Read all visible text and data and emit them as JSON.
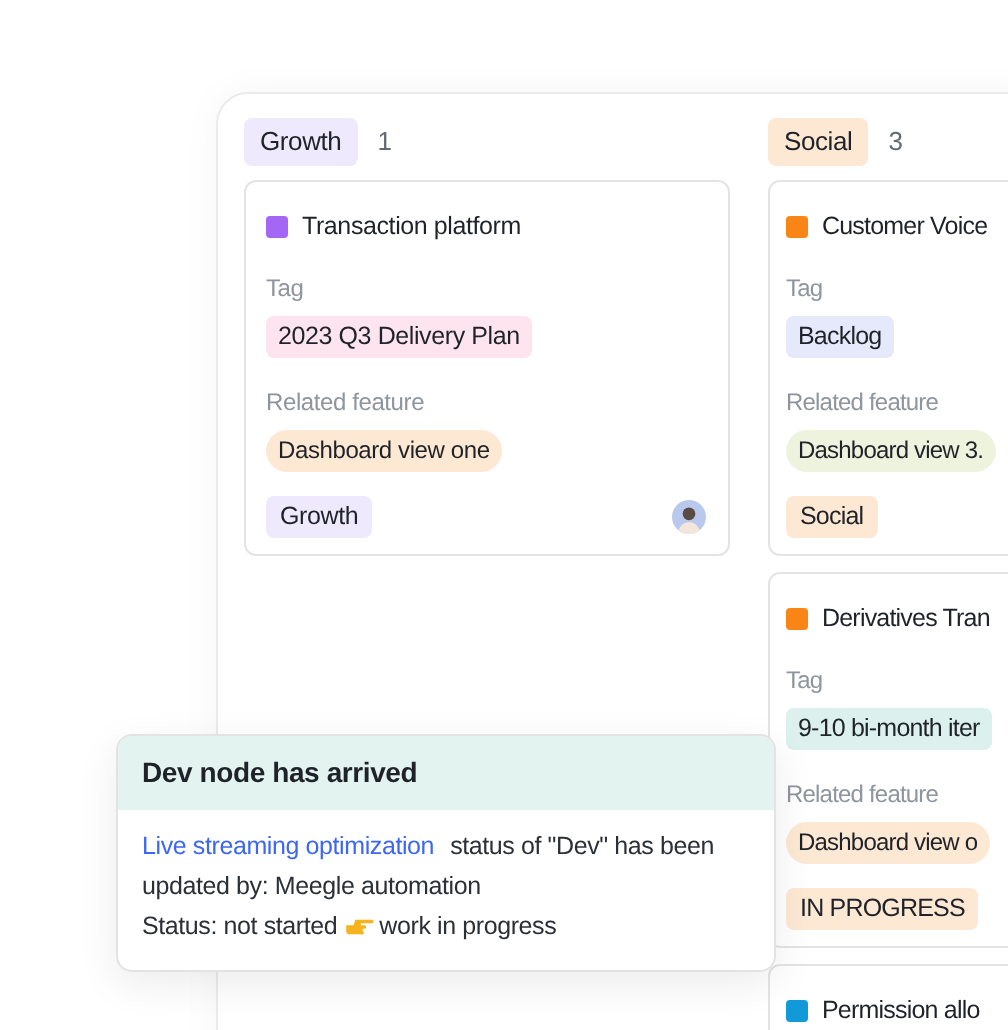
{
  "columns": [
    {
      "name": "Growth",
      "count": "1",
      "color": "#efe9fd",
      "cards": [
        {
          "title": "Transaction platform",
          "color": "#a466f5",
          "tag_label": "Tag",
          "tag": {
            "text": "2023 Q3 Delivery Plan",
            "color": "#fde4ef"
          },
          "related_label": "Related feature",
          "related": {
            "text": "Dashboard view one",
            "color": "#fde8d4"
          },
          "footer": {
            "text": "Growth",
            "color": "#efe9fd"
          },
          "avatar": true
        }
      ]
    },
    {
      "name": "Social",
      "count": "3",
      "color": "#fde8d4",
      "cards": [
        {
          "title": "Customer Voice",
          "color": "#f98516",
          "tag_label": "Tag",
          "tag": {
            "text": "Backlog",
            "color": "#e6e9fb"
          },
          "related_label": "Related feature",
          "related": {
            "text": "Dashboard view 3.",
            "color": "#eef3dd"
          },
          "footer": {
            "text": "Social",
            "color": "#fde8d4"
          }
        },
        {
          "title": "Derivatives Tran",
          "color": "#f98516",
          "tag_label": "Tag",
          "tag": {
            "text": "9-10 bi-month iter",
            "color": "#dcf1ee"
          },
          "related_label": "Related feature",
          "related": {
            "text": "Dashboard view o",
            "color": "#fde8d4"
          },
          "footer": {
            "text": "IN PROGRESS",
            "color": "#fde8d4"
          }
        },
        {
          "title": "Permission allo",
          "color": "#119ad8"
        }
      ]
    }
  ],
  "notification": {
    "title": "Dev node has arrived",
    "link": "Live streaming optimization",
    "message": "status of \"Dev\" has been updated by: Meegle automation",
    "status_from": "Status: not started",
    "status_to": "work in progress"
  }
}
